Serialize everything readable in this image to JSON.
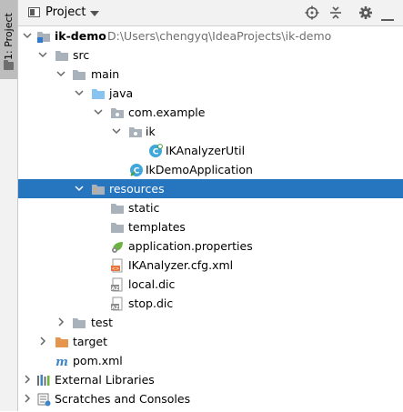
{
  "sidebar_tab": {
    "label": "1: Project"
  },
  "header": {
    "title": "Project"
  },
  "tree": [
    {
      "label": "ik-demo",
      "path": "D:\\Users\\chengyq\\IdeaProjects\\ik-demo"
    },
    {
      "label": "src"
    },
    {
      "label": "main"
    },
    {
      "label": "java"
    },
    {
      "label": "com.example"
    },
    {
      "label": "ik"
    },
    {
      "label": "IKAnalyzerUtil"
    },
    {
      "label": "IkDemoApplication"
    },
    {
      "label": "resources"
    },
    {
      "label": "static"
    },
    {
      "label": "templates"
    },
    {
      "label": "application.properties"
    },
    {
      "label": "IKAnalyzer.cfg.xml"
    },
    {
      "label": "local.dic"
    },
    {
      "label": "stop.dic"
    },
    {
      "label": "test"
    },
    {
      "label": "target"
    },
    {
      "label": "pom.xml"
    },
    {
      "label": "External Libraries"
    },
    {
      "label": "Scratches and Consoles"
    }
  ],
  "colors": {
    "selection": "#2675bf",
    "folder_gray": "#a9b2bb",
    "folder_blue": "#87c4ef",
    "folder_orange": "#e6964c",
    "class_icon": "#3fa7d9"
  }
}
